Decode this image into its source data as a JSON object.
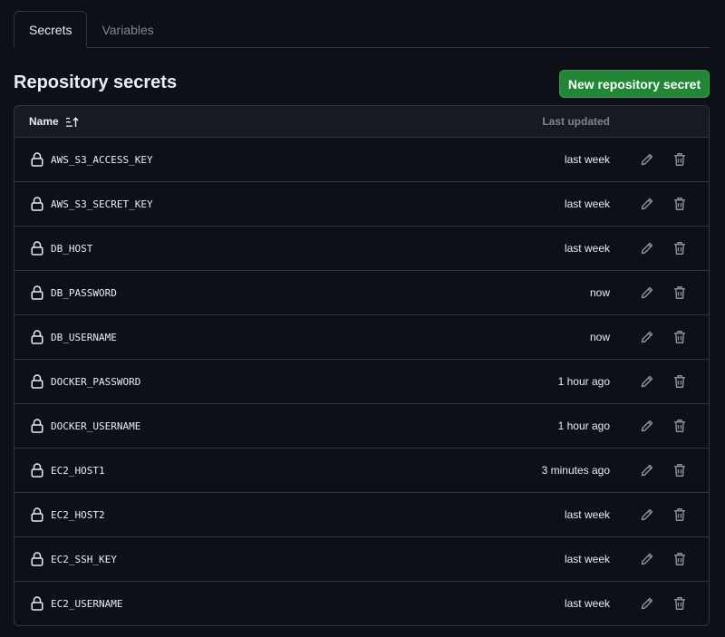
{
  "tabs": {
    "secrets": "Secrets",
    "variables": "Variables"
  },
  "header": {
    "title": "Repository secrets",
    "new_button": "New repository secret"
  },
  "table": {
    "col_name": "Name",
    "col_updated": "Last updated",
    "rows": [
      {
        "name": "AWS_S3_ACCESS_KEY",
        "updated": "last week"
      },
      {
        "name": "AWS_S3_SECRET_KEY",
        "updated": "last week"
      },
      {
        "name": "DB_HOST",
        "updated": "last week"
      },
      {
        "name": "DB_PASSWORD",
        "updated": "now"
      },
      {
        "name": "DB_USERNAME",
        "updated": "now"
      },
      {
        "name": "DOCKER_PASSWORD",
        "updated": "1 hour ago"
      },
      {
        "name": "DOCKER_USERNAME",
        "updated": "1 hour ago"
      },
      {
        "name": "EC2_HOST1",
        "updated": "3 minutes ago"
      },
      {
        "name": "EC2_HOST2",
        "updated": "last week"
      },
      {
        "name": "EC2_SSH_KEY",
        "updated": "last week"
      },
      {
        "name": "EC2_USERNAME",
        "updated": "last week"
      }
    ]
  },
  "icons": {
    "row_icon": "lock-icon",
    "edit": "pencil-icon",
    "delete": "trash-icon",
    "sort": "sort-ascending-icon"
  },
  "colors": {
    "background": "#0d1117",
    "primary_button": "#238636",
    "border": "#30363d",
    "muted_text": "#7d8590"
  }
}
